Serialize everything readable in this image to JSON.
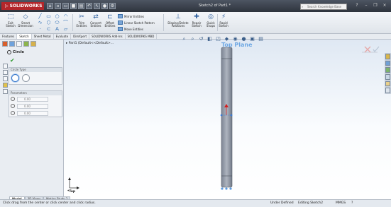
{
  "titlebar": {
    "logo_text": "SOLIDWORKS",
    "doc_title": "Sketch2 of Part1 *",
    "search_placeholder": "Search Knowledge Base"
  },
  "commands": {
    "exit_sketch": "Exit Sketch",
    "smart_dimension": "Smart Dimension",
    "trim_entities": "Trim Entities",
    "convert_entities": "Convert Entities",
    "offset_entities": "Offset Entities",
    "mirror_entities": "Mirror Entities",
    "linear_sketch_pattern": "Linear Sketch Pattern",
    "move_entities": "Move Entities",
    "display_delete_relations": "Display/Delete Relations",
    "repair_sketch": "Repair Sketch",
    "quick_snaps": "Quick Snaps",
    "rapid_sketch": "Rapid Sketch"
  },
  "tabs": [
    "Features",
    "Sketch",
    "Sheet Metal",
    "Evaluate",
    "DimXpert",
    "SOLIDWORKS Add-Ins",
    "SOLIDWORKS MBD"
  ],
  "active_tab": "Sketch",
  "property_manager": {
    "title": "Circle",
    "circle_type_label": "Circle Type",
    "parameters_label": "Parameters",
    "param_values": [
      "0.00",
      "0.00",
      "0.00"
    ]
  },
  "viewport": {
    "tree_label": "Part1  (Default<<Default>...",
    "plane_label": "Top Plane",
    "view_label": "*Top"
  },
  "bottom_tabs": [
    "Model",
    "3D Views",
    "Motion Study 1"
  ],
  "status": {
    "message": "Click drag from the center or click center and click radius.",
    "definition": "Under Defined",
    "editing": "Editing Sketch2",
    "units": "MMGS"
  },
  "colors": {
    "title_bg": "#3a4049",
    "logo_red": "#b3262a",
    "plane_blue": "#6fa8e4"
  }
}
